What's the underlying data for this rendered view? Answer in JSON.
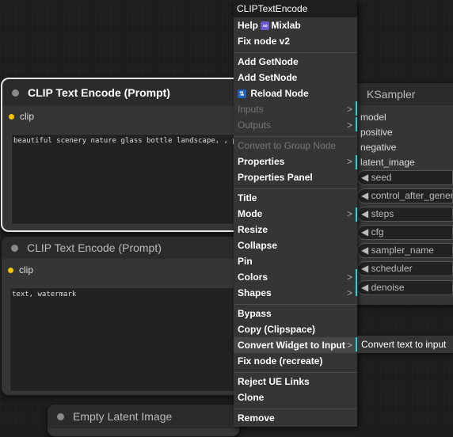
{
  "nodes": {
    "clip1": {
      "title": "CLIP Text Encode (Prompt)",
      "input": "clip",
      "text": "beautiful scenery nature glass bottle landscape, , purple"
    },
    "clip2": {
      "title": "CLIP Text Encode (Prompt)",
      "input": "clip",
      "text": "text, watermark"
    },
    "empty_latent": {
      "title": "Empty Latent Image"
    },
    "ksampler": {
      "title": "KSampler",
      "inputs": [
        "model",
        "positive",
        "negative",
        "latent_image"
      ],
      "widgets": [
        "seed",
        "control_after_generate",
        "steps",
        "cfg",
        "sampler_name",
        "scheduler",
        "denoise"
      ]
    }
  },
  "context_menu": {
    "title": "CLIPTextEncode",
    "items": [
      {
        "label": "Help",
        "extra": "Mixlab"
      },
      {
        "label": "Fix node v2"
      },
      {
        "label": "Add GetNode"
      },
      {
        "label": "Add SetNode"
      },
      {
        "label": "Reload Node"
      },
      {
        "label": "Inputs",
        "arrow": ">"
      },
      {
        "label": "Outputs",
        "arrow": ">"
      },
      {
        "label": "Convert to Group Node"
      },
      {
        "label": "Properties",
        "arrow": ">"
      },
      {
        "label": "Properties Panel"
      },
      {
        "label": "Title"
      },
      {
        "label": "Mode",
        "arrow": ">"
      },
      {
        "label": "Resize"
      },
      {
        "label": "Collapse"
      },
      {
        "label": "Pin"
      },
      {
        "label": "Colors",
        "arrow": ">"
      },
      {
        "label": "Shapes",
        "arrow": ">"
      },
      {
        "label": "Bypass"
      },
      {
        "label": "Copy (Clipspace)"
      },
      {
        "label": "Convert Widget to Input",
        "arrow": ">"
      },
      {
        "label": "Fix node (recreate)"
      },
      {
        "label": "Reject UE Links"
      },
      {
        "label": "Clone"
      },
      {
        "label": "Remove"
      }
    ]
  },
  "submenu": {
    "item": "Convert text to input"
  },
  "colors": {
    "accent_cyan": "#2bd4d4",
    "clip_dot": "#f5c400",
    "badge_mixlab": "#6a5acd",
    "badge_reload": "#1f5fbf"
  },
  "icons": {
    "mixlab_badge": "infinity-badge-icon",
    "reload_badge": "reload-badge-icon"
  }
}
